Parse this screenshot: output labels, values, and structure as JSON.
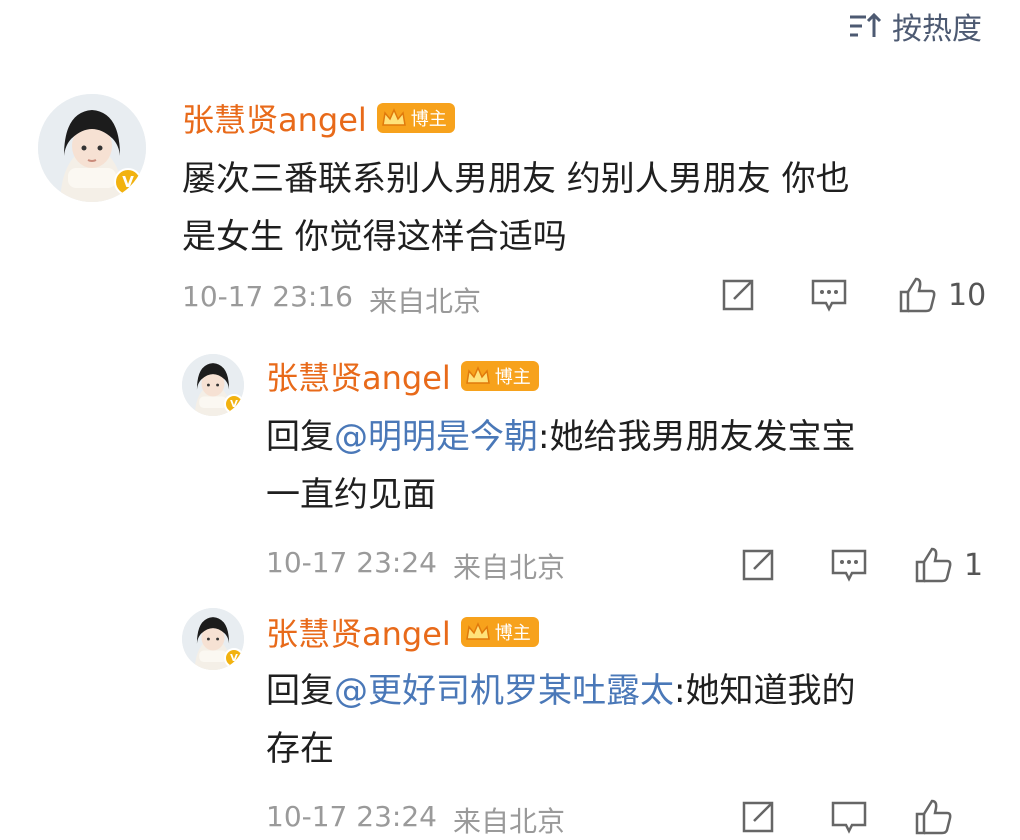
{
  "sort": {
    "label": "按热度",
    "icon": "sort-icon"
  },
  "comments": [
    {
      "username": "张慧贤angel",
      "badge": "博主",
      "text": "屡次三番联系别人男朋友 约别人男朋友 你也是女生 你觉得这样合适吗",
      "line1": "屡次三番联系别人男朋友 约别人男朋友 你也",
      "line2": "是女生 你觉得这样合适吗",
      "date": "10-17 23:16",
      "location": "来自北京",
      "likes": "10"
    },
    {
      "username": "张慧贤angel",
      "badge": "博主",
      "reply_prefix": "回复",
      "mention": "@明明是今朝",
      "line1_rest": ":她给我男朋友发宝宝",
      "line2": "一直约见面",
      "date": "10-17 23:24",
      "location": "来自北京",
      "likes": "1"
    },
    {
      "username": "张慧贤angel",
      "badge": "博主",
      "reply_prefix": "回复",
      "mention": "@更好司机罗某吐露太",
      "line1_rest": ":她知道我的",
      "line2": "存在",
      "date": "10-17 23:24",
      "location": "来自北京",
      "likes": ""
    }
  ],
  "colors": {
    "username": "#e86a1a",
    "mention": "#4a78b8",
    "meta": "#9a9a9a",
    "badge": "#f7a21c",
    "verified": "#f2b20f"
  }
}
